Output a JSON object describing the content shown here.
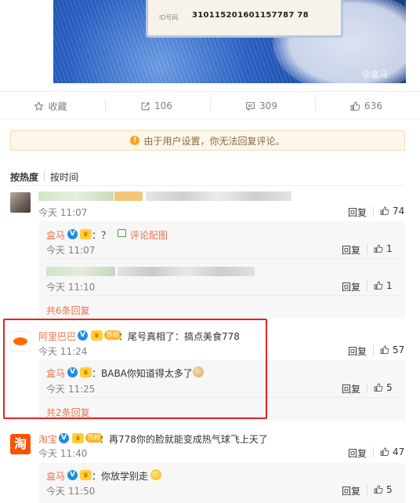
{
  "photo": {
    "id_label": "ID号码",
    "id_number": "310115201601157787 78",
    "watermark": "@盒马"
  },
  "actions": {
    "favorite": "收藏",
    "repost": "106",
    "comment": "309",
    "like": "636"
  },
  "notice": {
    "text": "由于用户设置，你无法回复评论。"
  },
  "sort": {
    "hot": "按热度",
    "time": "按时间"
  },
  "labels": {
    "reply": "回复"
  },
  "comments": [
    {
      "time": "今天 11:07",
      "likes": "74",
      "replies": [
        {
          "name": "盒马",
          "text": "：？",
          "link": "评论配图",
          "time": "今天 11:07",
          "likes": "1"
        },
        {
          "time": "今天 11:10",
          "likes": "1"
        }
      ],
      "more": "共6条回复"
    },
    {
      "name": "阿里巴巴",
      "fan_badge": "铁粉",
      "text": "：尾号真相了：搞点美食778",
      "time": "今天 11:24",
      "likes": "57",
      "replies": [
        {
          "name": "盒马",
          "text": "：BABA你知道得太多了",
          "time": "今天 11:25",
          "likes": "5"
        }
      ],
      "more": "共2条回复"
    },
    {
      "name": "淘宝",
      "fan_badge": "铁粉",
      "text": "：再778你的脸就能变成热气球飞上天了",
      "time": "今天 11:40",
      "likes": "47",
      "replies": [
        {
          "name": "盒马",
          "text": "：你放学别走",
          "time": "今天 11:50",
          "likes": "5"
        }
      ]
    }
  ],
  "icons": {
    "favorite": "star-icon",
    "repost": "share-icon",
    "comment": "comment-icon",
    "like": "thumbs-up-icon",
    "notice": "exclamation-icon",
    "verified": "verified-v-icon",
    "crown": "vip-crown-icon",
    "image": "image-icon"
  },
  "colors": {
    "link": "#eb7350",
    "verified": "#1f8de0",
    "highlight_box": "#e02424",
    "notice_bg": "#fdf6ec"
  }
}
